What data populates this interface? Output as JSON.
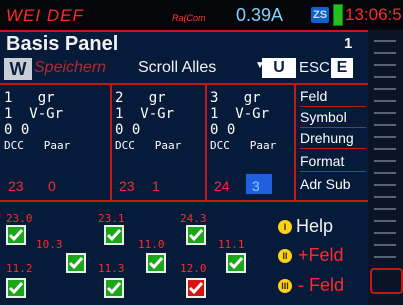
{
  "status": {
    "title": "WEI DEF",
    "logo": "Ra(Com",
    "current": "0.39A",
    "zs_badge": "ZS",
    "time": "13:06:5"
  },
  "panel": {
    "title": "Basis Panel",
    "page": "1",
    "toolbar": {
      "w_key": "W",
      "speichern": "Speichern",
      "scroll": "Scroll Alles",
      "u_key": "U",
      "esc": "ESC",
      "e_key": "E"
    },
    "blocks": [
      {
        "num": "1",
        "gr": "gr",
        "row2a": "1",
        "vgr": "V-Gr",
        "row3": "0  0",
        "dcc": "DCC",
        "paar": "Paar",
        "addr": "23",
        "sub": "0"
      },
      {
        "num": "2",
        "gr": "gr",
        "row2a": "1",
        "vgr": "V-Gr",
        "row3": "0  0",
        "dcc": "DCC",
        "paar": "Paar",
        "addr": "23",
        "sub": "1"
      },
      {
        "num": "3",
        "gr": "gr",
        "row2a": "1",
        "vgr": "V-Gr",
        "row3": "0  0",
        "dcc": "DCC",
        "paar": "Paar",
        "addr": "24",
        "sub": "3"
      }
    ],
    "menu": [
      "Feld",
      "Symbol",
      "Drehung",
      "Format",
      "Adr Sub"
    ],
    "checks_top": [
      {
        "label": "23.0",
        "state": "on"
      },
      {
        "label": "23.1",
        "state": "on"
      },
      {
        "label": "24.3",
        "state": "on"
      }
    ],
    "checks_mid": [
      {
        "label": "10.3",
        "state": "on"
      },
      {
        "label": "11.0",
        "state": "on"
      },
      {
        "label": "11.1",
        "state": "on"
      }
    ],
    "checks_bottom": [
      {
        "label": "11.2",
        "state": "on"
      },
      {
        "label": "11.3",
        "state": "on"
      },
      {
        "label": "12.0",
        "state": "off"
      }
    ],
    "actions": {
      "help": "Help",
      "help_icon": "I",
      "add": "+Feld",
      "add_icon": "II",
      "remove": "- Feld",
      "remove_icon": "III"
    }
  }
}
